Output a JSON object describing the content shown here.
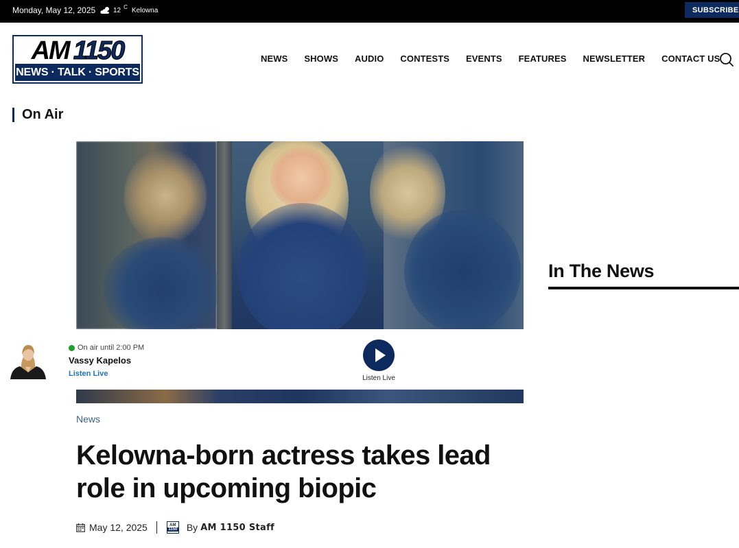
{
  "topbar": {
    "date": "Monday, May 12, 2025",
    "weather_icon": "cloud-sun-icon",
    "temperature": "12",
    "unit": "C",
    "city": "Kelowna",
    "subscribe_label": "SUBSCRIBE"
  },
  "logo": {
    "am_text": "AM",
    "freq_text": "1150",
    "tagline": "NEWS · TALK · SPORTS"
  },
  "nav": {
    "items": [
      "NEWS",
      "SHOWS",
      "AUDIO",
      "CONTESTS",
      "EVENTS",
      "FEATURES",
      "NEWSLETTER",
      "CONTACT US"
    ],
    "search_icon": "search-icon"
  },
  "on_air": {
    "heading": "On Air",
    "status": "On air until 2:00 PM",
    "host": "Vassy Kapelos",
    "listen_link": "Listen Live",
    "play_label": "Listen Live"
  },
  "article": {
    "category": "News",
    "headline": "Kelowna-born actress takes lead role in upcoming biopic",
    "date": "May 12, 2025",
    "by": "By",
    "author": "AM 1150 Staff"
  },
  "sidebar": {
    "heading": "In The News"
  },
  "colors": {
    "brand_navy": "#0d2a5e",
    "link_blue": "#1e73be",
    "live_green": "#1f9d2d"
  }
}
